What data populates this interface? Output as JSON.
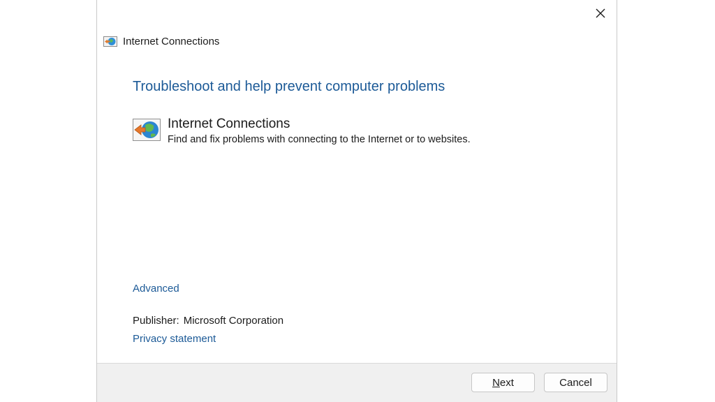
{
  "window": {
    "title": "Internet Connections"
  },
  "main": {
    "heading": "Troubleshoot and help prevent computer problems",
    "item": {
      "title": "Internet Connections",
      "description": "Find and fix problems with connecting to the Internet or to websites."
    },
    "advanced_link": "Advanced",
    "publisher_label": "Publisher:",
    "publisher_value": "Microsoft Corporation",
    "privacy_link": "Privacy statement"
  },
  "footer": {
    "next_mnemonic": "N",
    "next_rest": "ext",
    "cancel_label": "Cancel"
  },
  "icons": {
    "close": "close-icon",
    "app": "internet-connections-icon",
    "item": "internet-troubleshooter-icon"
  },
  "colors": {
    "link": "#1c5a97",
    "text": "#1b1b1b",
    "footer_bg": "#f0f0f0"
  }
}
